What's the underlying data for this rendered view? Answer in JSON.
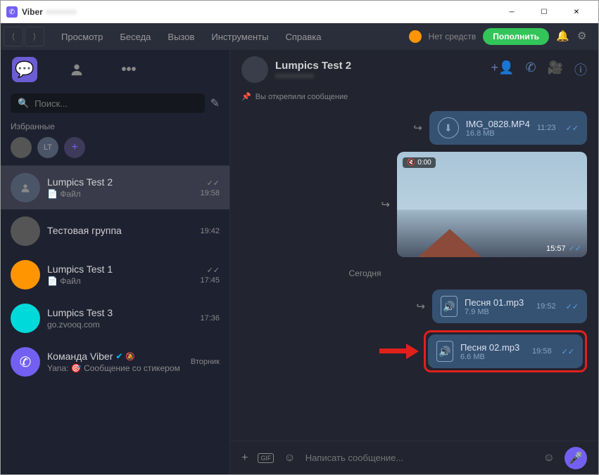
{
  "window": {
    "title": "Viber"
  },
  "menu": {
    "items": [
      "Просмотр",
      "Беседа",
      "Вызов",
      "Инструменты",
      "Справка"
    ],
    "balance": "Нет средств",
    "topup": "Пополнить"
  },
  "search": {
    "placeholder": "Поиск..."
  },
  "favorites": {
    "label": "Избранные",
    "lt": "LT"
  },
  "chats": [
    {
      "name": "Lumpics Test 2",
      "preview": "📄 Файл",
      "time": "19:58",
      "checked": true,
      "avatar": "profile",
      "selected": true
    },
    {
      "name": "Тестовая группа",
      "preview": "",
      "time": "19:42",
      "avatar": "group"
    },
    {
      "name": "Lumpics Test 1",
      "preview": "📄 Файл",
      "time": "17:45",
      "checked": true,
      "avatar": "orange"
    },
    {
      "name": "Lumpics Test 3",
      "preview": "go.zvooq.com",
      "time": "17:36",
      "avatar": "cyan"
    },
    {
      "name": "Команда Viber",
      "preview": "Yana: 🎯 Сообщение со стикером",
      "time": "Вторник",
      "avatar": "viber",
      "verified": true,
      "muted": true
    }
  ],
  "header": {
    "name": "Lumpics Test 2",
    "pinned": "Вы открепили сообщение"
  },
  "messages": {
    "video_file": {
      "name": "IMG_0828.MP4",
      "size": "16.8 MB",
      "time": "11:23"
    },
    "video": {
      "mute": "🔇 0:00",
      "time": "15:57"
    },
    "date": "Сегодня",
    "file1": {
      "name": "Песня 01.mp3",
      "size": "7.9 MB",
      "time": "19:52"
    },
    "file2": {
      "name": "Песня 02.mp3",
      "size": "6.6 MB",
      "time": "19:58"
    }
  },
  "composer": {
    "placeholder": "Написать сообщение...",
    "gif": "GIF"
  }
}
